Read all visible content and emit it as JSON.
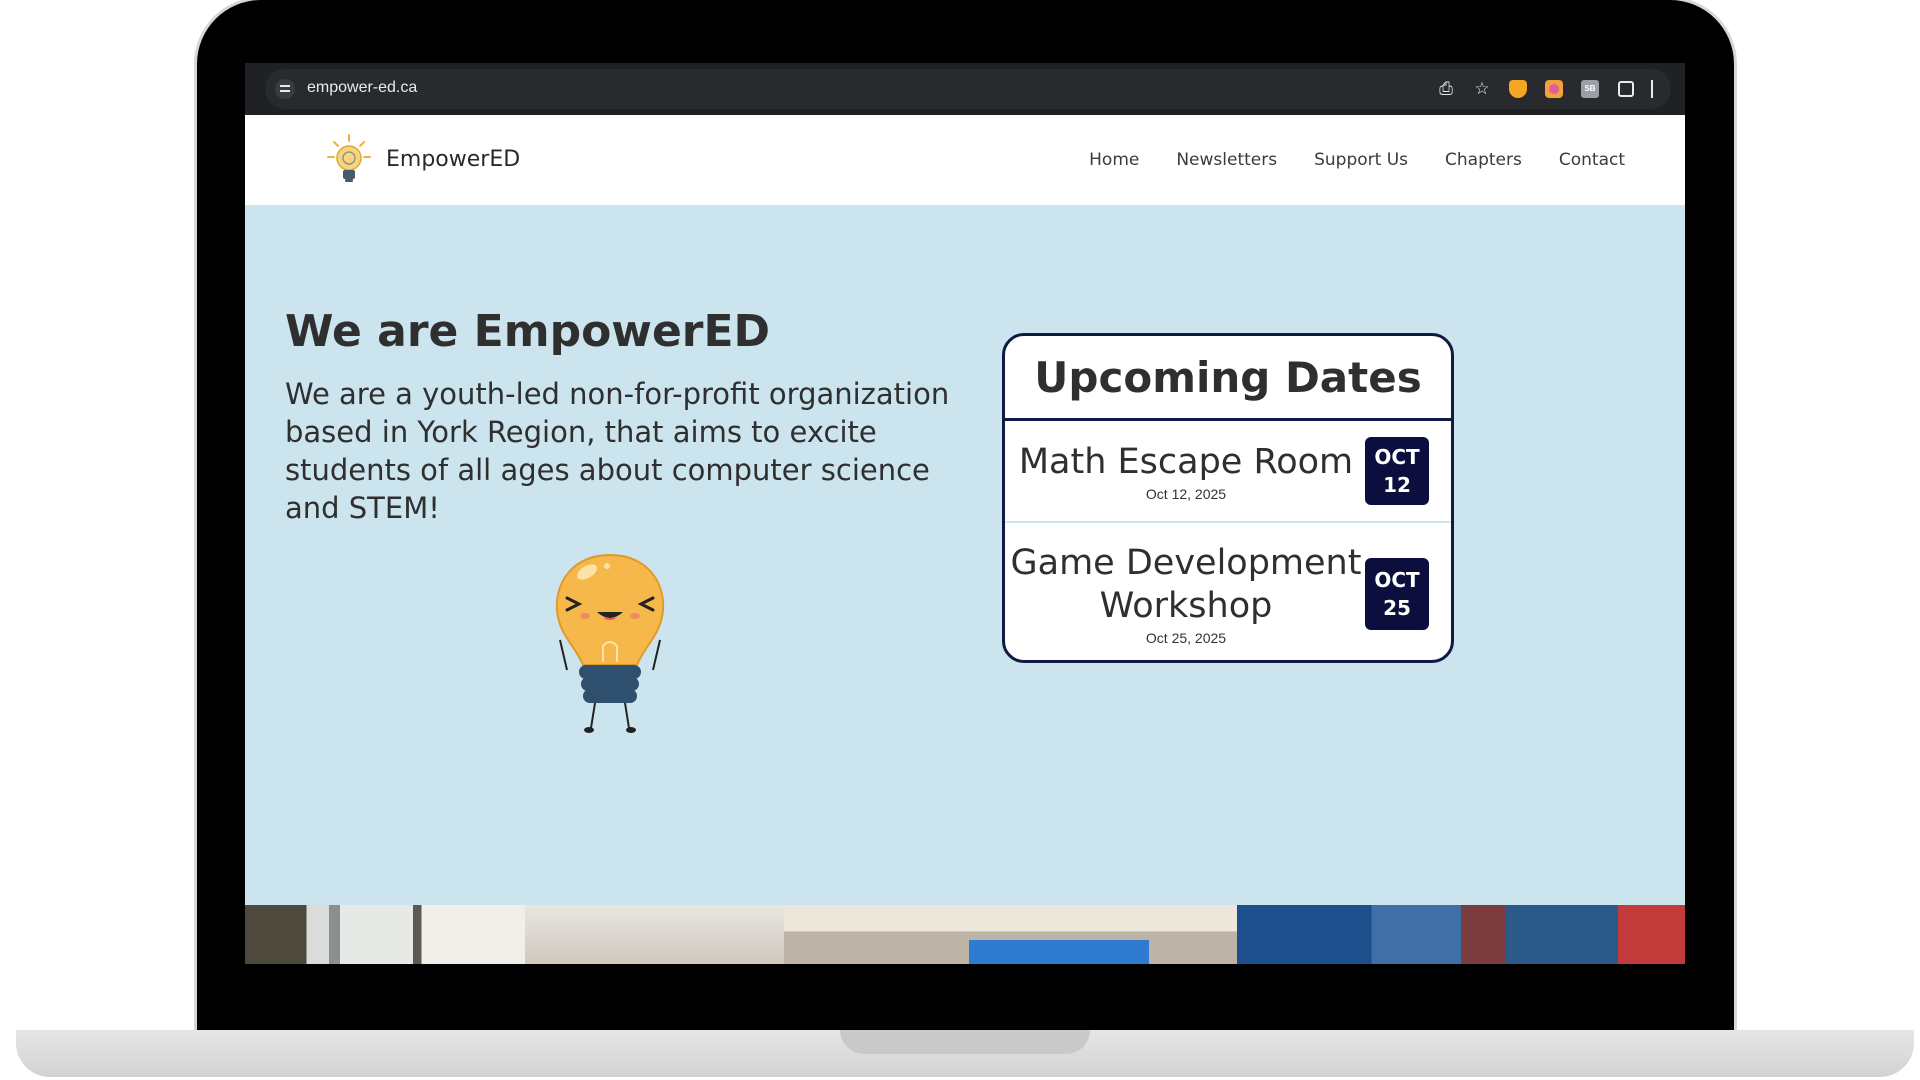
{
  "browser": {
    "url": "empower-ed.ca",
    "ext_gray_label": "SB"
  },
  "site": {
    "brand": "EmpowerED",
    "nav": [
      "Home",
      "Newsletters",
      "Support Us",
      "Chapters",
      "Contact"
    ]
  },
  "hero": {
    "title": "We are EmpowerED",
    "text": "We are a youth-led non-for-profit organization based in York Region, that aims to excite students of all ages about computer science and STEM!"
  },
  "events": {
    "title": "Upcoming Dates",
    "items": [
      {
        "name": "Math Escape Room",
        "date": "Oct 12, 2025",
        "month": "OCT",
        "day": "12"
      },
      {
        "name": "Game Development Workshop",
        "date": "Oct 25, 2025",
        "month": "OCT",
        "day": "25"
      }
    ]
  },
  "colors": {
    "hero_bg": "#cce4ee",
    "badge_bg": "#0c0e3e",
    "card_border": "#0e1a44",
    "mascot": "#f7b84b"
  },
  "icons": [
    "tune-icon",
    "install-icon",
    "star-icon",
    "extension-shield-icon",
    "extension-flower-icon",
    "extension-sb-icon",
    "puzzle-icon"
  ]
}
